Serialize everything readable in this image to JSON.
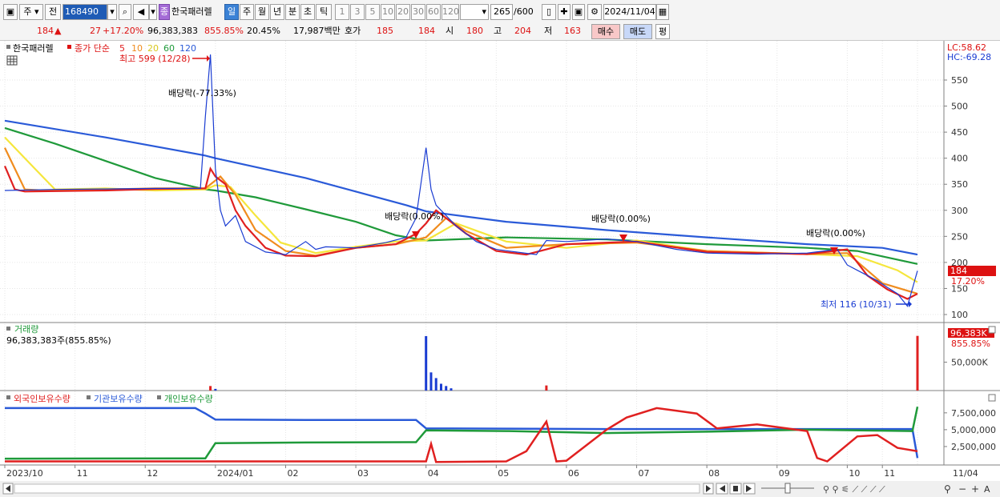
{
  "toolbar": {
    "period_label": "주",
    "prev_label": "전",
    "stock_code": "168490",
    "badge_label": "종",
    "stock_name": "한국패러렐",
    "interval_buttons": [
      "일",
      "주",
      "월",
      "년",
      "분",
      "초",
      "틱"
    ],
    "active_interval": "일",
    "number_buttons": [
      "1",
      "3",
      "5",
      "10",
      "20",
      "30",
      "60",
      "120"
    ],
    "count_current": "265",
    "count_total": "/600",
    "date": "2024/11/04"
  },
  "quote": {
    "price": "184",
    "change": "27",
    "change_pct": "+17.20%",
    "volume": "96,383,383",
    "volume_ratio": "855.85%",
    "turnover": "20.45%",
    "amount": "17,987백만",
    "hoga_label": "호가",
    "ask": "185",
    "bid": "184",
    "open_label": "시",
    "open": "180",
    "high_label": "고",
    "high": "204",
    "low_label": "저",
    "low": "163",
    "buy_label": "매수",
    "sell_label": "매도",
    "avg_label": "평"
  },
  "colors": {
    "ma5": "#e02020",
    "ma10": "#f08c1e",
    "ma20": "#f5e63c",
    "ma60": "#1f9a3a",
    "ma120": "#2a5ad8",
    "up": "#e02020",
    "down": "#1a3cd2",
    "foreign": "#e02020",
    "institution": "#2a5ad8",
    "individual": "#1f9a3a"
  },
  "chart_data": [
    {
      "type": "line",
      "title": "한국패러렐",
      "legend": {
        "series_label": "종가 단순",
        "periods": [
          "5",
          "10",
          "20",
          "60",
          "120"
        ]
      },
      "annotations": {
        "high": "최고 599 (12/28)",
        "low": "최저 116 (10/31)",
        "dividend_1": "배당락(-77.33%)",
        "dividend_2": "배당락(0.00%)",
        "dividend_3": "배당락(0.00%)",
        "dividend_4": "배당락(0.00%)"
      },
      "corner_labels": {
        "lc": "LC:58.62",
        "hc": "HC:-69.28"
      },
      "current_price_tag": {
        "price": "184",
        "change": "17.20%"
      },
      "y_ticks": [
        "550",
        "500",
        "450",
        "400",
        "350",
        "300",
        "250",
        "200",
        "150",
        "100"
      ],
      "ylim": [
        100,
        560
      ],
      "x_ticks": [
        "2023/10",
        "11",
        "12",
        "2024/01",
        "02",
        "03",
        "04",
        "05",
        "06",
        "07",
        "08",
        "09",
        "10",
        "11",
        "11/04"
      ],
      "x_index": [
        0,
        14,
        28,
        42,
        56,
        70,
        84,
        98,
        112,
        126,
        140,
        154,
        168,
        175,
        182
      ],
      "series": [
        {
          "name": "120",
          "x": [
            0,
            20,
            40,
            42,
            60,
            80,
            84,
            100,
            120,
            140,
            160,
            175,
            182
          ],
          "values": [
            472,
            440,
            405,
            400,
            362,
            310,
            298,
            278,
            262,
            248,
            235,
            228,
            215
          ]
        },
        {
          "name": "60",
          "x": [
            0,
            10,
            20,
            30,
            40,
            42,
            50,
            60,
            70,
            78,
            84,
            100,
            120,
            140,
            160,
            170,
            182
          ],
          "values": [
            458,
            428,
            395,
            362,
            340,
            338,
            325,
            302,
            278,
            252,
            242,
            248,
            244,
            235,
            228,
            222,
            197
          ]
        },
        {
          "name": "20",
          "x": [
            0,
            6,
            10,
            20,
            30,
            40,
            42,
            45,
            50,
            55,
            62,
            70,
            78,
            84,
            90,
            100,
            112,
            126,
            140,
            160,
            170,
            178,
            182
          ],
          "values": [
            440,
            380,
            340,
            342,
            338,
            340,
            348,
            345,
            290,
            238,
            218,
            230,
            240,
            242,
            275,
            240,
            228,
            242,
            222,
            216,
            212,
            185,
            162
          ]
        },
        {
          "name": "10",
          "x": [
            0,
            4,
            8,
            20,
            30,
            40,
            43,
            46,
            50,
            56,
            62,
            70,
            78,
            84,
            88,
            92,
            100,
            112,
            126,
            140,
            160,
            168,
            175,
            182
          ],
          "values": [
            420,
            340,
            338,
            340,
            342,
            342,
            365,
            330,
            262,
            222,
            213,
            228,
            235,
            248,
            285,
            260,
            228,
            235,
            238,
            222,
            216,
            218,
            160,
            140
          ]
        },
        {
          "name": "5",
          "x": [
            0,
            2,
            4,
            20,
            30,
            40,
            41,
            42,
            44,
            46,
            48,
            52,
            56,
            62,
            70,
            78,
            82,
            84,
            86,
            88,
            92,
            98,
            104,
            112,
            126,
            140,
            160,
            168,
            172,
            176,
            180,
            182
          ],
          "values": [
            385,
            340,
            336,
            338,
            341,
            342,
            380,
            365,
            350,
            300,
            270,
            228,
            213,
            212,
            228,
            235,
            255,
            275,
            300,
            285,
            255,
            222,
            215,
            235,
            240,
            220,
            216,
            225,
            175,
            148,
            130,
            140
          ]
        },
        {
          "name": "price",
          "x": [
            0,
            10,
            20,
            30,
            39,
            40,
            41,
            42,
            43,
            44,
            46,
            48,
            52,
            56,
            60,
            62,
            64,
            70,
            76,
            80,
            82,
            84,
            85,
            86,
            88,
            90,
            94,
            98,
            102,
            106,
            108,
            112,
            120,
            126,
            134,
            140,
            150,
            160,
            166,
            168,
            170,
            174,
            176,
            178,
            180,
            182
          ],
          "values": [
            338,
            340,
            341,
            342,
            342,
            480,
            599,
            380,
            300,
            270,
            290,
            240,
            220,
            215,
            240,
            225,
            230,
            228,
            238,
            248,
            285,
            420,
            340,
            310,
            290,
            270,
            240,
            225,
            220,
            215,
            242,
            240,
            245,
            240,
            225,
            218,
            216,
            218,
            225,
            195,
            185,
            165,
            152,
            140,
            116,
            184
          ]
        }
      ]
    },
    {
      "type": "bar",
      "title": "거래량",
      "readout": "96,383,383주(855.85%)",
      "y_ticks": [
        "50,000K"
      ],
      "current_tag": {
        "value": "96,383K",
        "ratio": "855.85%"
      },
      "ylim": [
        0,
        110000000
      ],
      "bars": [
        {
          "x": 41,
          "value": 8000000,
          "up": true
        },
        {
          "x": 42,
          "value": 3000000,
          "up": false
        },
        {
          "x": 84,
          "value": 96000000,
          "up": false
        },
        {
          "x": 85,
          "value": 32000000,
          "up": false
        },
        {
          "x": 86,
          "value": 22000000,
          "up": false
        },
        {
          "x": 87,
          "value": 12000000,
          "up": false
        },
        {
          "x": 88,
          "value": 8000000,
          "up": false
        },
        {
          "x": 89,
          "value": 4000000,
          "up": false
        },
        {
          "x": 108,
          "value": 9000000,
          "up": true
        },
        {
          "x": 182,
          "value": 96383383,
          "up": true
        }
      ]
    },
    {
      "type": "line",
      "legend": [
        "외국인보유수량",
        "기관보유수량",
        "개인보유수량"
      ],
      "y_ticks": [
        "7,500,000",
        "5,000,000",
        "2,500,000"
      ],
      "ylim": [
        0,
        9500000
      ],
      "series": [
        {
          "name": "기관보유수량",
          "x": [
            0,
            38,
            40,
            42,
            60,
            82,
            84,
            100,
            120,
            140,
            160,
            181,
            182
          ],
          "values": [
            8200000,
            8200000,
            7400000,
            6500000,
            6450000,
            6450000,
            5200000,
            5150000,
            5100000,
            5100000,
            5100000,
            5100000,
            800000
          ]
        },
        {
          "name": "개인보유수량",
          "x": [
            0,
            40,
            42,
            60,
            82,
            84,
            100,
            120,
            140,
            160,
            181,
            182
          ],
          "values": [
            700000,
            750000,
            3000000,
            3100000,
            3150000,
            4900000,
            4800000,
            4500000,
            4700000,
            5000000,
            4800000,
            8400000
          ]
        },
        {
          "name": "외국인보유수량",
          "x": [
            0,
            84,
            85,
            86,
            100,
            104,
            108,
            110,
            112,
            120,
            124,
            130,
            134,
            138,
            142,
            150,
            160,
            162,
            164,
            170,
            174,
            178,
            182
          ],
          "values": [
            300000,
            300000,
            2900000,
            200000,
            300000,
            1800000,
            6200000,
            300000,
            400000,
            5000000,
            6800000,
            8200000,
            7800000,
            7400000,
            5200000,
            5800000,
            4800000,
            800000,
            300000,
            4000000,
            4200000,
            2300000,
            1800000
          ]
        }
      ]
    }
  ]
}
